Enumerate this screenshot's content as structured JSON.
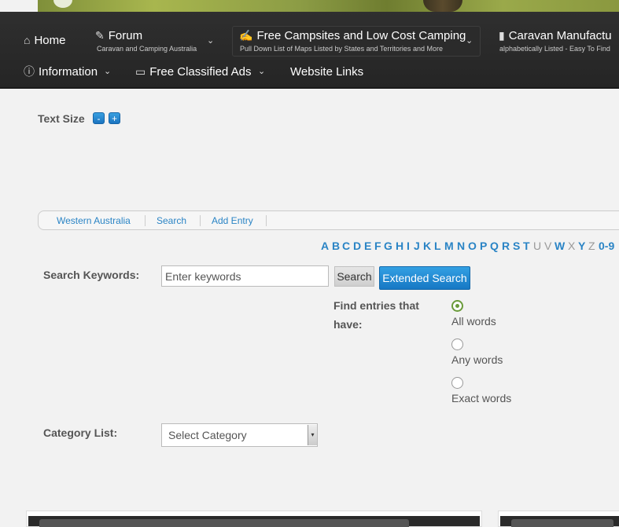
{
  "nav": {
    "home": "Home",
    "forum": "Forum",
    "forum_sub": "Caravan and Camping Australia",
    "campsites": "Free Campsites and Low Cost Camping",
    "campsites_sub": "Pull Down List of Maps Listed by States and Territories and More",
    "manufacturers": "Caravan Manufactu",
    "manufacturers_sub": "alphabetically Listed - Easy To Find",
    "information": "Information",
    "classified": "Free Classified Ads",
    "links": "Website Links"
  },
  "text_size": {
    "label": "Text Size",
    "minus": "-",
    "plus": "+"
  },
  "breadcrumb": {
    "items": [
      "Western Australia",
      "Search",
      "Add Entry"
    ]
  },
  "alphabet": {
    "letters": [
      "A",
      "B",
      "C",
      "D",
      "E",
      "F",
      "G",
      "H",
      "I",
      "J",
      "K",
      "L",
      "M",
      "N",
      "O",
      "P",
      "Q",
      "R",
      "S",
      "T",
      "U",
      "V",
      "W",
      "X",
      "Y",
      "Z",
      "0-9"
    ]
  },
  "search": {
    "keywords_label": "Search Keywords:",
    "placeholder": "Enter keywords",
    "search_button": "Search",
    "extended_button": "Extended Search",
    "find_label": "Find entries that have:",
    "options": [
      "All words",
      "Any words",
      "Exact words"
    ],
    "selected_option": "All words",
    "category_label": "Category List:",
    "category_value": "Select Category"
  },
  "colors": {
    "accent": "#2a84c5",
    "nav_bg": "#2b2b2b",
    "button_blue": "#1b7cc8"
  }
}
